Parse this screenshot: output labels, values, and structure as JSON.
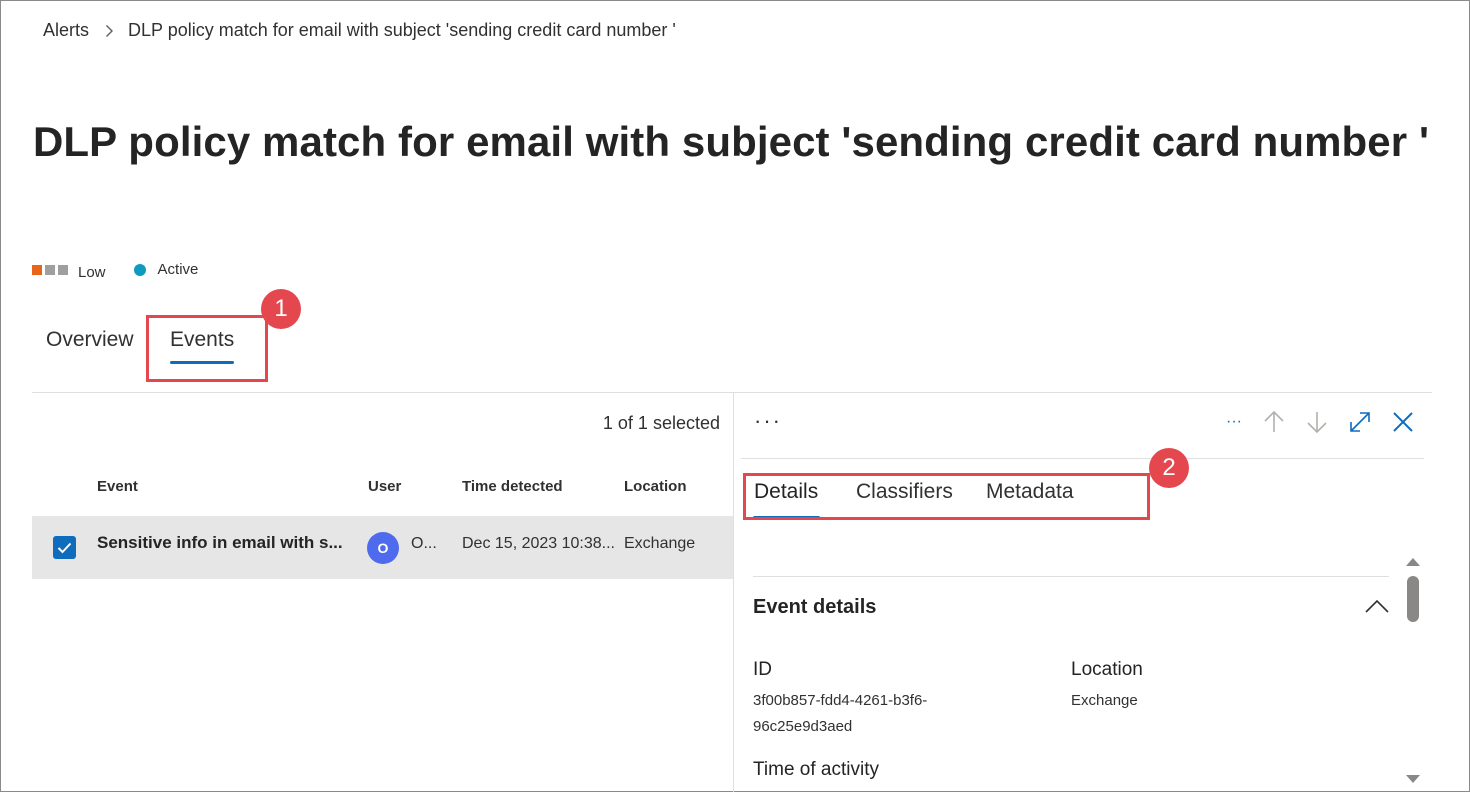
{
  "breadcrumb": {
    "root": "Alerts",
    "current": "DLP policy match for email with subject 'sending credit card number '"
  },
  "page_title": "DLP policy match for email with subject 'sending credit card number '",
  "severity": {
    "label": "Low",
    "colors": [
      "#e8641b",
      "#a19f9d",
      "#a19f9d"
    ]
  },
  "status": {
    "label": "Active",
    "color": "#0f9bbd"
  },
  "tabs": [
    {
      "label": "Overview",
      "active": false
    },
    {
      "label": "Events",
      "active": true
    }
  ],
  "annotations": {
    "badge_1": "1",
    "badge_2": "2",
    "color": "#e5474f"
  },
  "events_list": {
    "selected_count": "1 of 1 selected",
    "columns": [
      "Event",
      "User",
      "Time detected",
      "Location"
    ],
    "rows": [
      {
        "selected": true,
        "event": "Sensitive info in email with s...",
        "user_initial": "O",
        "user": "O...",
        "time_detected": "Dec 15, 2023 10:38...",
        "location": "Exchange"
      }
    ]
  },
  "detail_pane": {
    "more_label": "···",
    "toolbar": {
      "more": "···",
      "prev_icon": "arrow-up-icon",
      "next_icon": "arrow-down-icon",
      "expand_icon": "expand-icon",
      "close_icon": "close-icon"
    },
    "tabs": [
      {
        "label": "Details",
        "active": true
      },
      {
        "label": "Classifiers",
        "active": false
      },
      {
        "label": "Metadata",
        "active": false
      }
    ],
    "section_title": "Event details",
    "fields": {
      "id_label": "ID",
      "id_value_line1": "3f00b857-fdd4-4261-b3f6-",
      "id_value_line2": "96c25e9d3aed",
      "location_label": "Location",
      "location_value": "Exchange",
      "time_label": "Time of activity"
    }
  },
  "accent_color": "#0f6cbd"
}
